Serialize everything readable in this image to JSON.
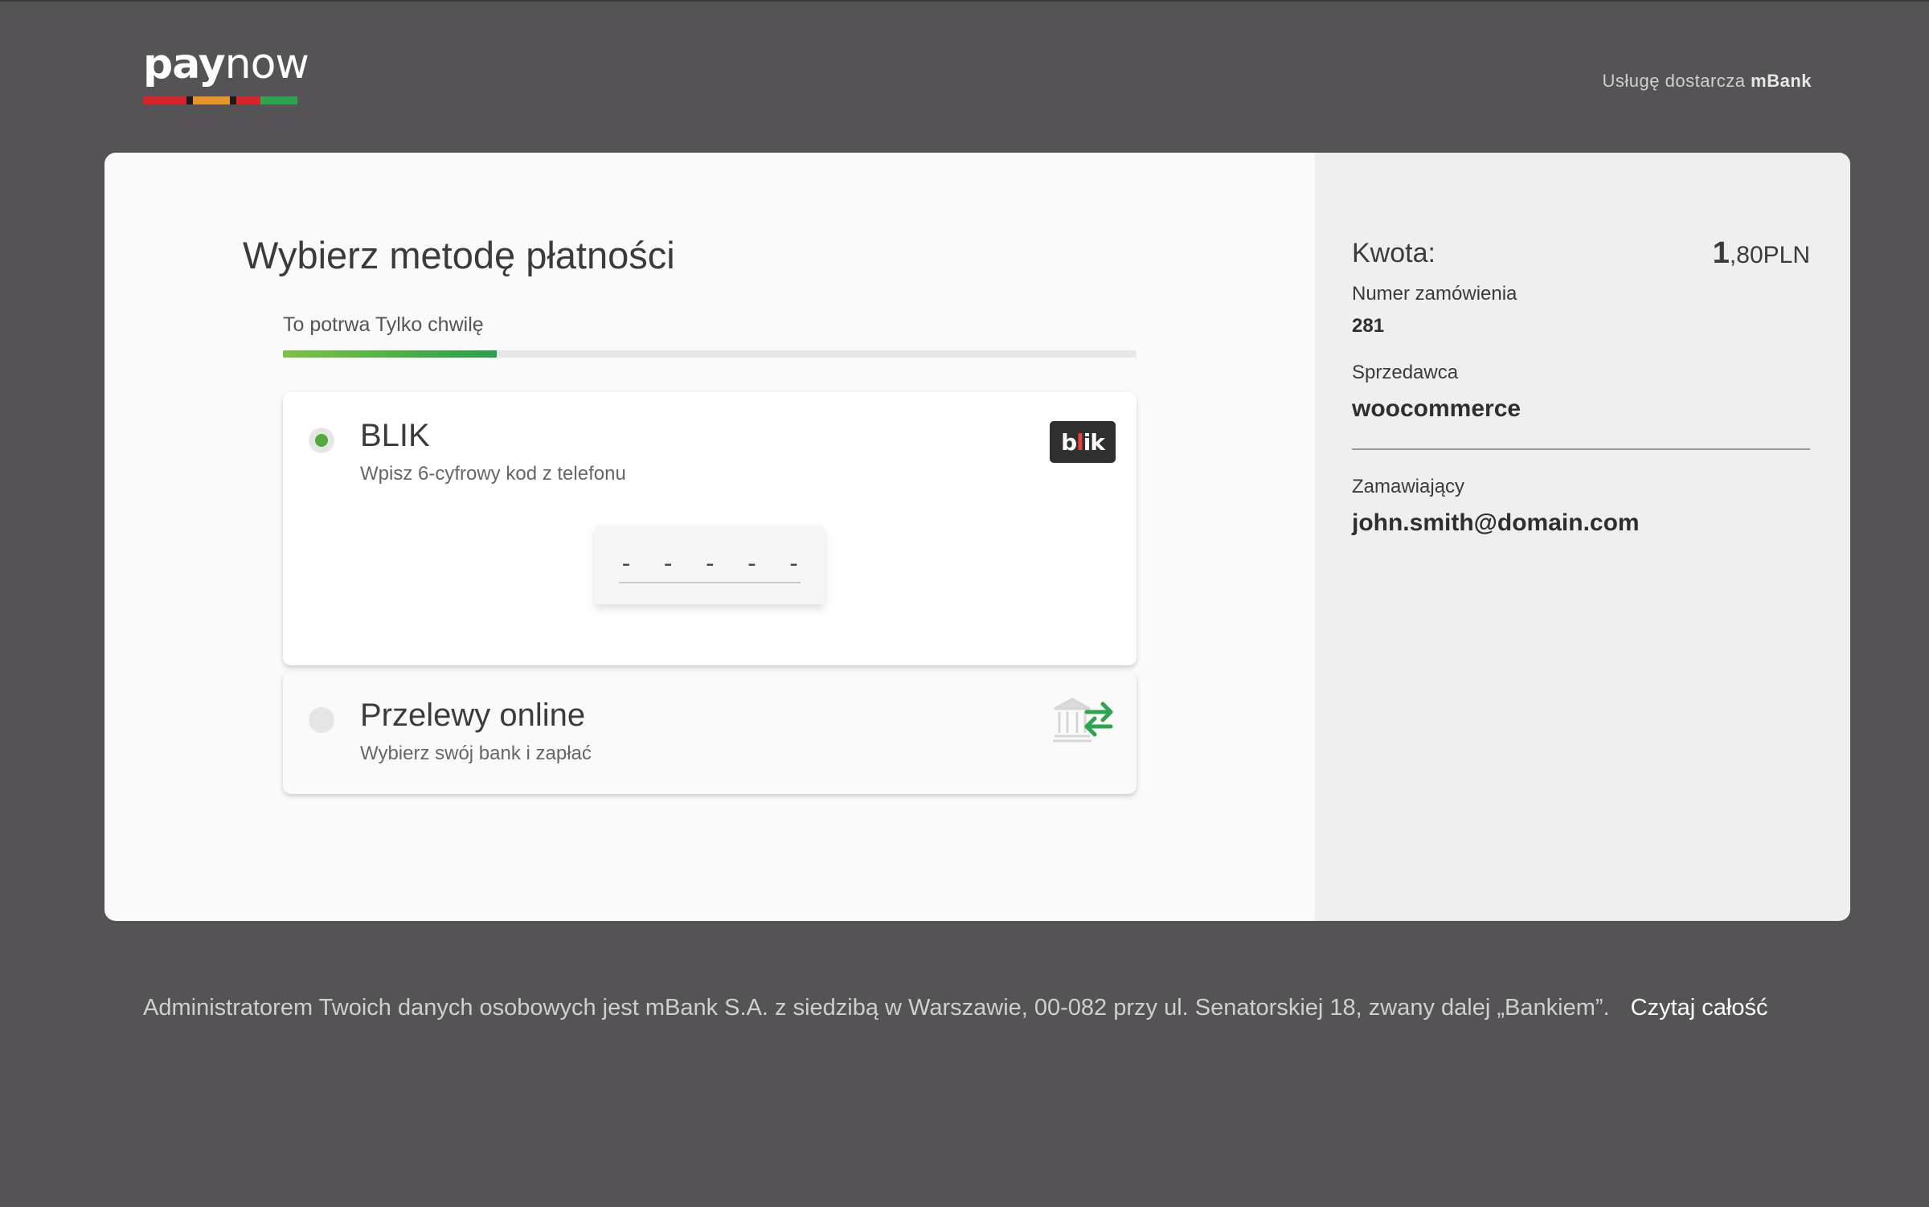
{
  "header": {
    "logo": {
      "part1": "pay",
      "part2": "now",
      "bar_colors": [
        "#d8232a",
        "#1a1a1a",
        "#e8962a",
        "#d8232a",
        "#2e8b57",
        "#2ea44f"
      ]
    },
    "provider_prefix": "Usługę dostarcza",
    "provider_name": "mBank"
  },
  "main": {
    "title": "Wybierz metodę płatności",
    "progress": {
      "label": "To potrwa Tylko chwilę",
      "value_percent": 25
    },
    "methods": [
      {
        "title": "BLIK",
        "subtitle": "Wpisz 6-cyfrowy kod z telefonu",
        "selected": true,
        "logo_text_a": "b",
        "logo_text_dot": "l",
        "logo_text_b": "ik",
        "code_placeholder": "- - - - - -",
        "icon": "blik-logo-icon"
      },
      {
        "title": "Przelewy online",
        "subtitle": "Wybierz swój bank i zapłać",
        "selected": false,
        "icon": "bank-transfer-icon"
      }
    ]
  },
  "summary": {
    "amount_label": "Kwota:",
    "amount_int": "1",
    "amount_rest": ",80PLN",
    "order_label": "Numer zamówienia",
    "order_value": "281",
    "seller_label": "Sprzedawca",
    "seller_value": "woocommerce",
    "buyer_label": "Zamawiający",
    "buyer_value": "john.smith@domain.com"
  },
  "footer": {
    "text": "Administratorem Twoich danych osobowych jest mBank S.A. z siedzibą w Warszawie, 00-082 przy ul. Senatorskiej 18, zwany dalej „Bankiem”.",
    "link": "Czytaj całość"
  },
  "colors": {
    "accent_green": "#52ab3a",
    "page_bg": "#555355"
  }
}
